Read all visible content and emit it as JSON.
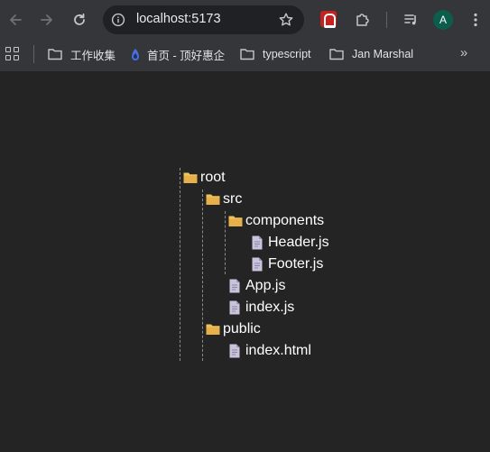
{
  "browser": {
    "url": "localhost:5173",
    "profile_initial": "A"
  },
  "bookmarks": [
    {
      "label": "工作收集",
      "icon": "folder-icon"
    },
    {
      "label": "首页 - 顶好惠企",
      "icon": "site-favicon"
    },
    {
      "label": "typescript",
      "icon": "folder-icon"
    },
    {
      "label": "Jan Marshal",
      "icon": "folder-icon"
    }
  ],
  "colors": {
    "page_background": "#242424",
    "folder": "#f0c05a",
    "file": "#c9c3dc",
    "guide": "#8a8a8a"
  },
  "tree": {
    "root": {
      "label": "root",
      "type": "folder"
    },
    "src": {
      "label": "src",
      "type": "folder"
    },
    "components": {
      "label": "components",
      "type": "folder"
    },
    "header": {
      "label": "Header.js",
      "type": "file"
    },
    "footer": {
      "label": "Footer.js",
      "type": "file"
    },
    "app": {
      "label": "App.js",
      "type": "file"
    },
    "index_js": {
      "label": "index.js",
      "type": "file"
    },
    "public": {
      "label": "public",
      "type": "folder"
    },
    "index_html": {
      "label": "index.html",
      "type": "file"
    }
  }
}
